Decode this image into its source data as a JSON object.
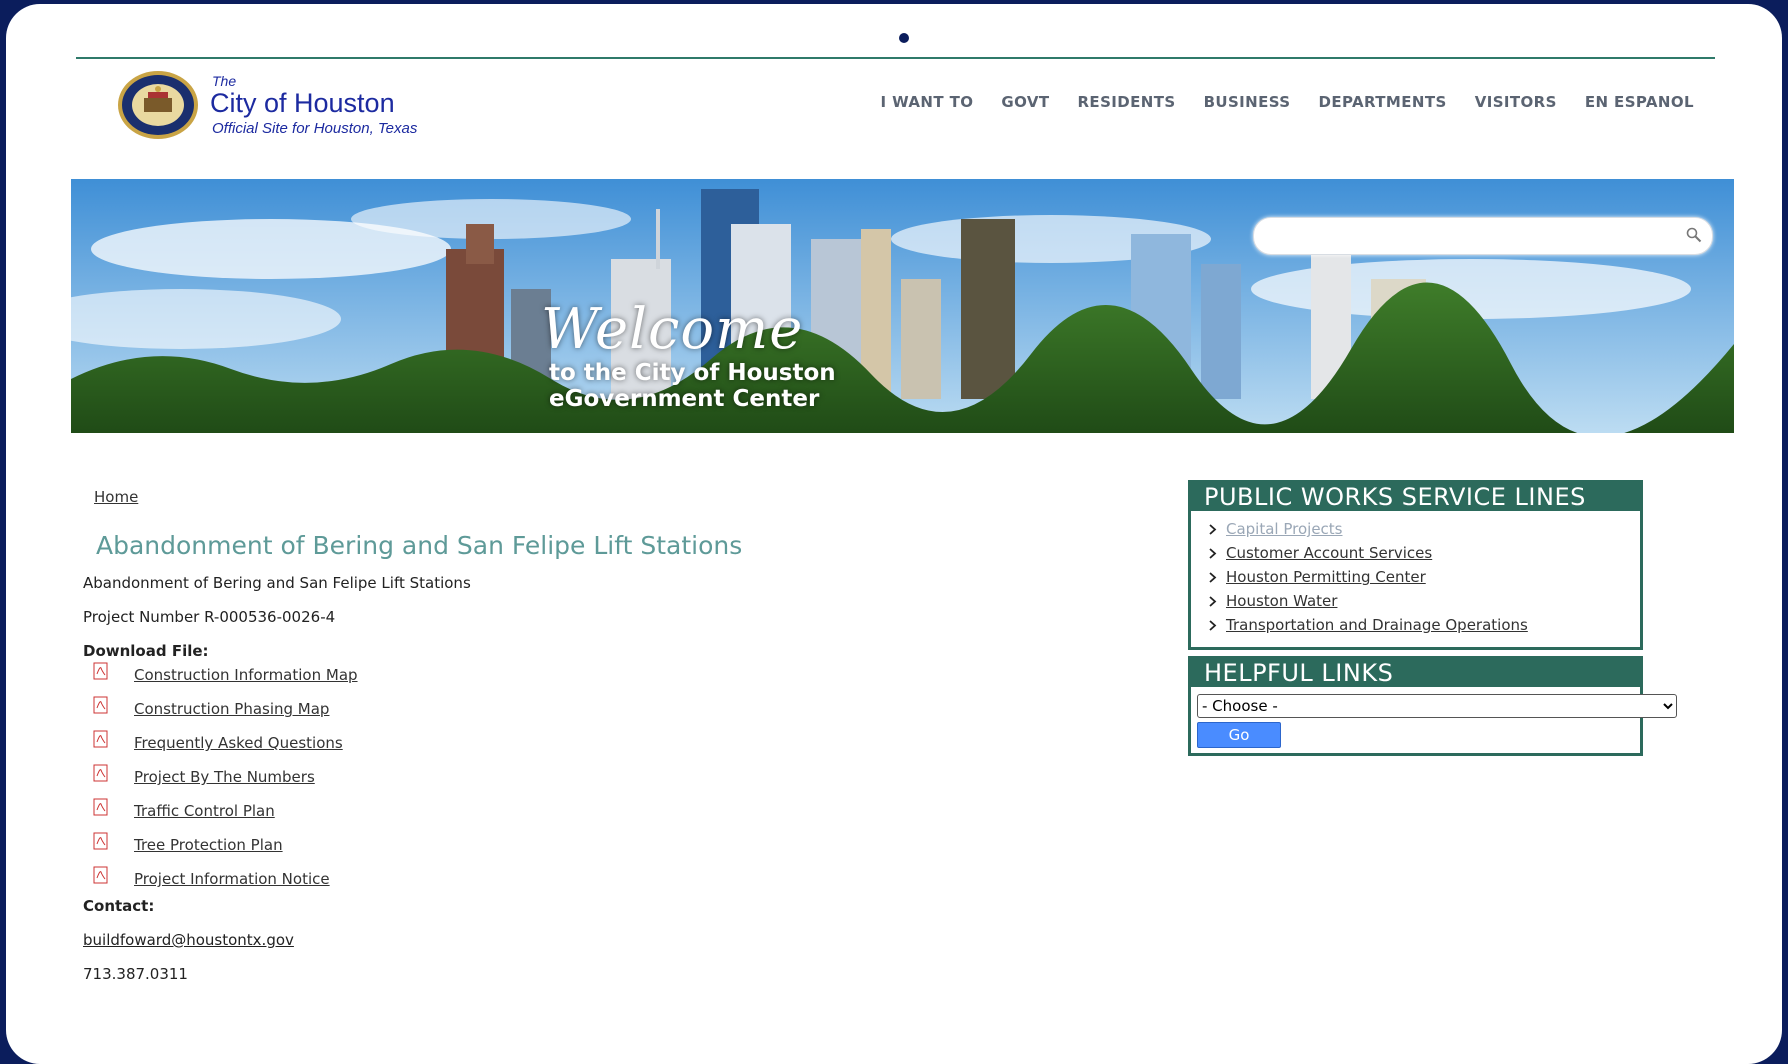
{
  "header": {
    "logo_the": "The",
    "logo_city": "City of Houston",
    "logo_tagline": "Official Site for Houston, Texas",
    "nav": [
      "I WANT TO",
      "GOVT",
      "RESIDENTS",
      "BUSINESS",
      "DEPARTMENTS",
      "VISITORS",
      "EN ESPANOL"
    ]
  },
  "banner": {
    "welcome": "Welcome",
    "line1": "to the City of Houston",
    "line2": "eGovernment Center",
    "search_value": ""
  },
  "breadcrumb": "Home",
  "title": "Abandonment of Bering and San Felipe Lift Stations",
  "subtitle": "Abandonment of Bering and San Felipe Lift Stations",
  "project_number": "Project Number R-000536-0026-4",
  "download_label": "Download File:",
  "files": [
    "Construction Information Map",
    "Construction Phasing Map",
    "Frequently Asked Questions",
    "Project By The Numbers",
    "Traffic Control Plan",
    "Tree Protection Plan",
    "Project Information Notice"
  ],
  "contact_label": "Contact:",
  "contact_email": "buildfoward@houstontx.gov",
  "contact_phone": "713.387.0311",
  "sidebar": {
    "service_title": "PUBLIC WORKS SERVICE LINES",
    "services": [
      "Capital Projects",
      "Customer Account Services",
      "Houston Permitting Center",
      "Houston Water",
      "Transportation and Drainage Operations"
    ],
    "helpful_title": "HELPFUL LINKS",
    "choose_option": "- Choose -",
    "go_label": "Go"
  },
  "colors": {
    "frame": "#0b1d5c",
    "accent": "#2c6a5c",
    "title": "#5e9a98",
    "logo": "#1c2aa0",
    "go_button": "#4a8cff"
  }
}
